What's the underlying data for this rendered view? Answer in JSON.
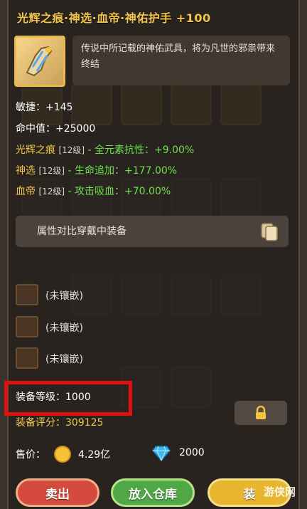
{
  "item": {
    "title": "光辉之痕·神选·血帝·神佑护手 +100",
    "description": "传说中所记载的神佑武具，将为凡世的邪祟带来终结",
    "icon": "gauntlet-icon"
  },
  "stats": [
    {
      "label": "敏捷：+145"
    },
    {
      "label": "命中值：+25000"
    }
  ],
  "affixes": [
    {
      "name": "光辉之痕",
      "level": "[12级]",
      "sep": " - ",
      "effect": "全元素抗性：+9.00%"
    },
    {
      "name": "神选",
      "level": "[12级]",
      "sep": " - ",
      "effect": "生命追加：+177.00%"
    },
    {
      "name": "血帝",
      "level": "[12级]",
      "sep": " - ",
      "effect": "攻击吸血：+70.00%"
    }
  ],
  "compare": {
    "label": "属性对比穿戴中装备",
    "icon": "copy-icon"
  },
  "sockets": [
    {
      "label": "(未镶嵌)"
    },
    {
      "label": "(未镶嵌)"
    },
    {
      "label": "(未镶嵌)"
    }
  ],
  "equip_level": "装备等级：1000",
  "equip_score": "装备评分：309125",
  "price": {
    "label": "售价：",
    "gold": "4.29亿",
    "diamonds": "2000"
  },
  "buttons": {
    "sell": "卖出",
    "store": "放入仓库",
    "equip": "装"
  },
  "watermark": "游侠网",
  "colors": {
    "gold_text": "#f3c64a",
    "green_text": "#6ee04c",
    "highlight": "#e01010"
  }
}
